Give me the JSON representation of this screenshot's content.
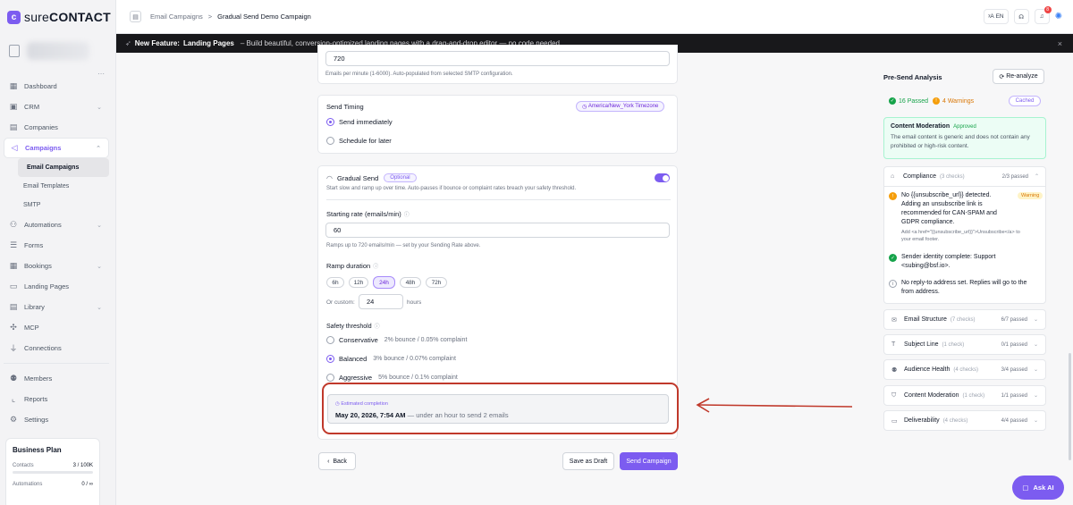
{
  "brand": {
    "name_light": "sure",
    "name_bold": "CONTACT",
    "logo_letter": "c"
  },
  "sidebar": {
    "items": [
      {
        "label": "Dashboard",
        "icon": "grid-icon"
      },
      {
        "label": "CRM",
        "icon": "contact-card-icon",
        "chevron": "⌄"
      },
      {
        "label": "Companies",
        "icon": "building-icon"
      },
      {
        "label": "Campaigns",
        "icon": "megaphone-icon",
        "chevron": "⌃"
      },
      {
        "label": "Automations",
        "icon": "workflow-icon",
        "chevron": "⌄"
      },
      {
        "label": "Forms",
        "icon": "form-icon"
      },
      {
        "label": "Bookings",
        "icon": "calendar-icon",
        "chevron": "⌄"
      },
      {
        "label": "Landing Pages",
        "icon": "layout-icon"
      },
      {
        "label": "Library",
        "icon": "library-icon",
        "chevron": "⌄"
      },
      {
        "label": "MCP",
        "icon": "mcp-icon"
      },
      {
        "label": "Connections",
        "icon": "plug-icon"
      },
      {
        "label": "Members",
        "icon": "users-icon"
      },
      {
        "label": "Reports",
        "icon": "chart-icon"
      },
      {
        "label": "Settings",
        "icon": "gear-icon"
      }
    ],
    "campaign_sub": [
      "Email Campaigns",
      "Email Templates",
      "SMTP"
    ],
    "plan": {
      "title": "Business Plan",
      "contacts_label": "Contacts",
      "contacts_value": "3 / 100K",
      "automations_label": "Automations",
      "automations_value": "0 / ∞"
    }
  },
  "header": {
    "crumb1": "Email Campaigns",
    "crumb_sep": ">",
    "crumb2": "Gradual Send Demo Campaign",
    "lang": "EN",
    "notif_count": "8"
  },
  "banner": {
    "lead": "New Feature:",
    "title": "Landing Pages",
    "desc": "– Build beautiful, conversion-optimized landing pages with a drag-and-drop editor — no code needed."
  },
  "form": {
    "rate_value": "720",
    "rate_help": "Emails per minute (1-6000). Auto-populated from selected SMTP configuration.",
    "timing_label": "Send Timing",
    "timezone": "America/New_York Timezone",
    "send_now": "Send immediately",
    "schedule": "Schedule for later",
    "gradual_label": "Gradual Send",
    "optional": "Optional",
    "gradual_help": "Start slow and ramp up over time. Auto-pauses if bounce or complaint rates breach your safety threshold.",
    "start_rate_label": "Starting rate (emails/min)",
    "start_rate_value": "60",
    "start_rate_help": "Ramps up to 720 emails/min — set by your Sending Rate above.",
    "ramp_label": "Ramp duration",
    "ramp_options": [
      "6h",
      "12h",
      "24h",
      "48h",
      "72h"
    ],
    "custom_label": "Or custom:",
    "custom_value": "24",
    "hours": "hours",
    "safety_label": "Safety threshold",
    "safety": [
      {
        "name": "Conservative",
        "desc": "2% bounce / 0.05% complaint"
      },
      {
        "name": "Balanced",
        "desc": "3% bounce / 0.07% complaint"
      },
      {
        "name": "Aggressive",
        "desc": "5% bounce / 0.1% complaint"
      }
    ],
    "est_label": "Estimated completion",
    "est_date": "May 20, 2026, 7:54 AM",
    "est_rest": "— under an hour to send 2 emails",
    "back": "Back",
    "draft": "Save as Draft",
    "send": "Send Campaign"
  },
  "analysis": {
    "title": "Pre-Send Analysis",
    "reanalyze": "Re-analyze",
    "passed": "16 Passed",
    "warnings": "4 Warnings",
    "cached": "Cached",
    "mod_title": "Content Moderation",
    "mod_badge": "Approved",
    "mod_desc": "The email content is generic and does not contain any prohibited or high-risk content.",
    "compliance": {
      "name": "Compliance",
      "count": "(3 checks)",
      "result": "2/3 passed"
    },
    "c1_a": "No {{unsubscribe_url}} detected.",
    "c1_b": "Adding an unsubscribe link is",
    "c1_c": "recommended for CAN-SPAM and",
    "c1_d": "GDPR compliance.",
    "c1_small1": "Add <a href=\"{{unsubscribe_url}}\">Unsubscribe</a> to",
    "c1_small2": "your email footer.",
    "warning": "Warning",
    "c2_a": "Sender identity complete: Support",
    "c2_b": "<subing@bsf.io>.",
    "c3_a": "No reply-to address set. Replies will go to the",
    "c3_b": "from address.",
    "sections": [
      {
        "name": "Email Structure",
        "count": "(7 checks)",
        "result": "6/7 passed",
        "icon": "envelope-icon"
      },
      {
        "name": "Subject Line",
        "count": "(1 check)",
        "result": "0/1 passed",
        "icon": "text-icon"
      },
      {
        "name": "Audience Health",
        "count": "(4 checks)",
        "result": "3/4 passed",
        "icon": "users-icon"
      },
      {
        "name": "Content Moderation",
        "count": "(1 check)",
        "result": "1/1 passed",
        "icon": "shield-icon"
      },
      {
        "name": "Deliverability",
        "count": "(4 checks)",
        "result": "4/4 passed",
        "icon": "inbox-icon"
      }
    ]
  },
  "ask_ai": "Ask AI",
  "colors": {
    "accent": "#7c5cf0",
    "annotation": "#c0392b"
  }
}
